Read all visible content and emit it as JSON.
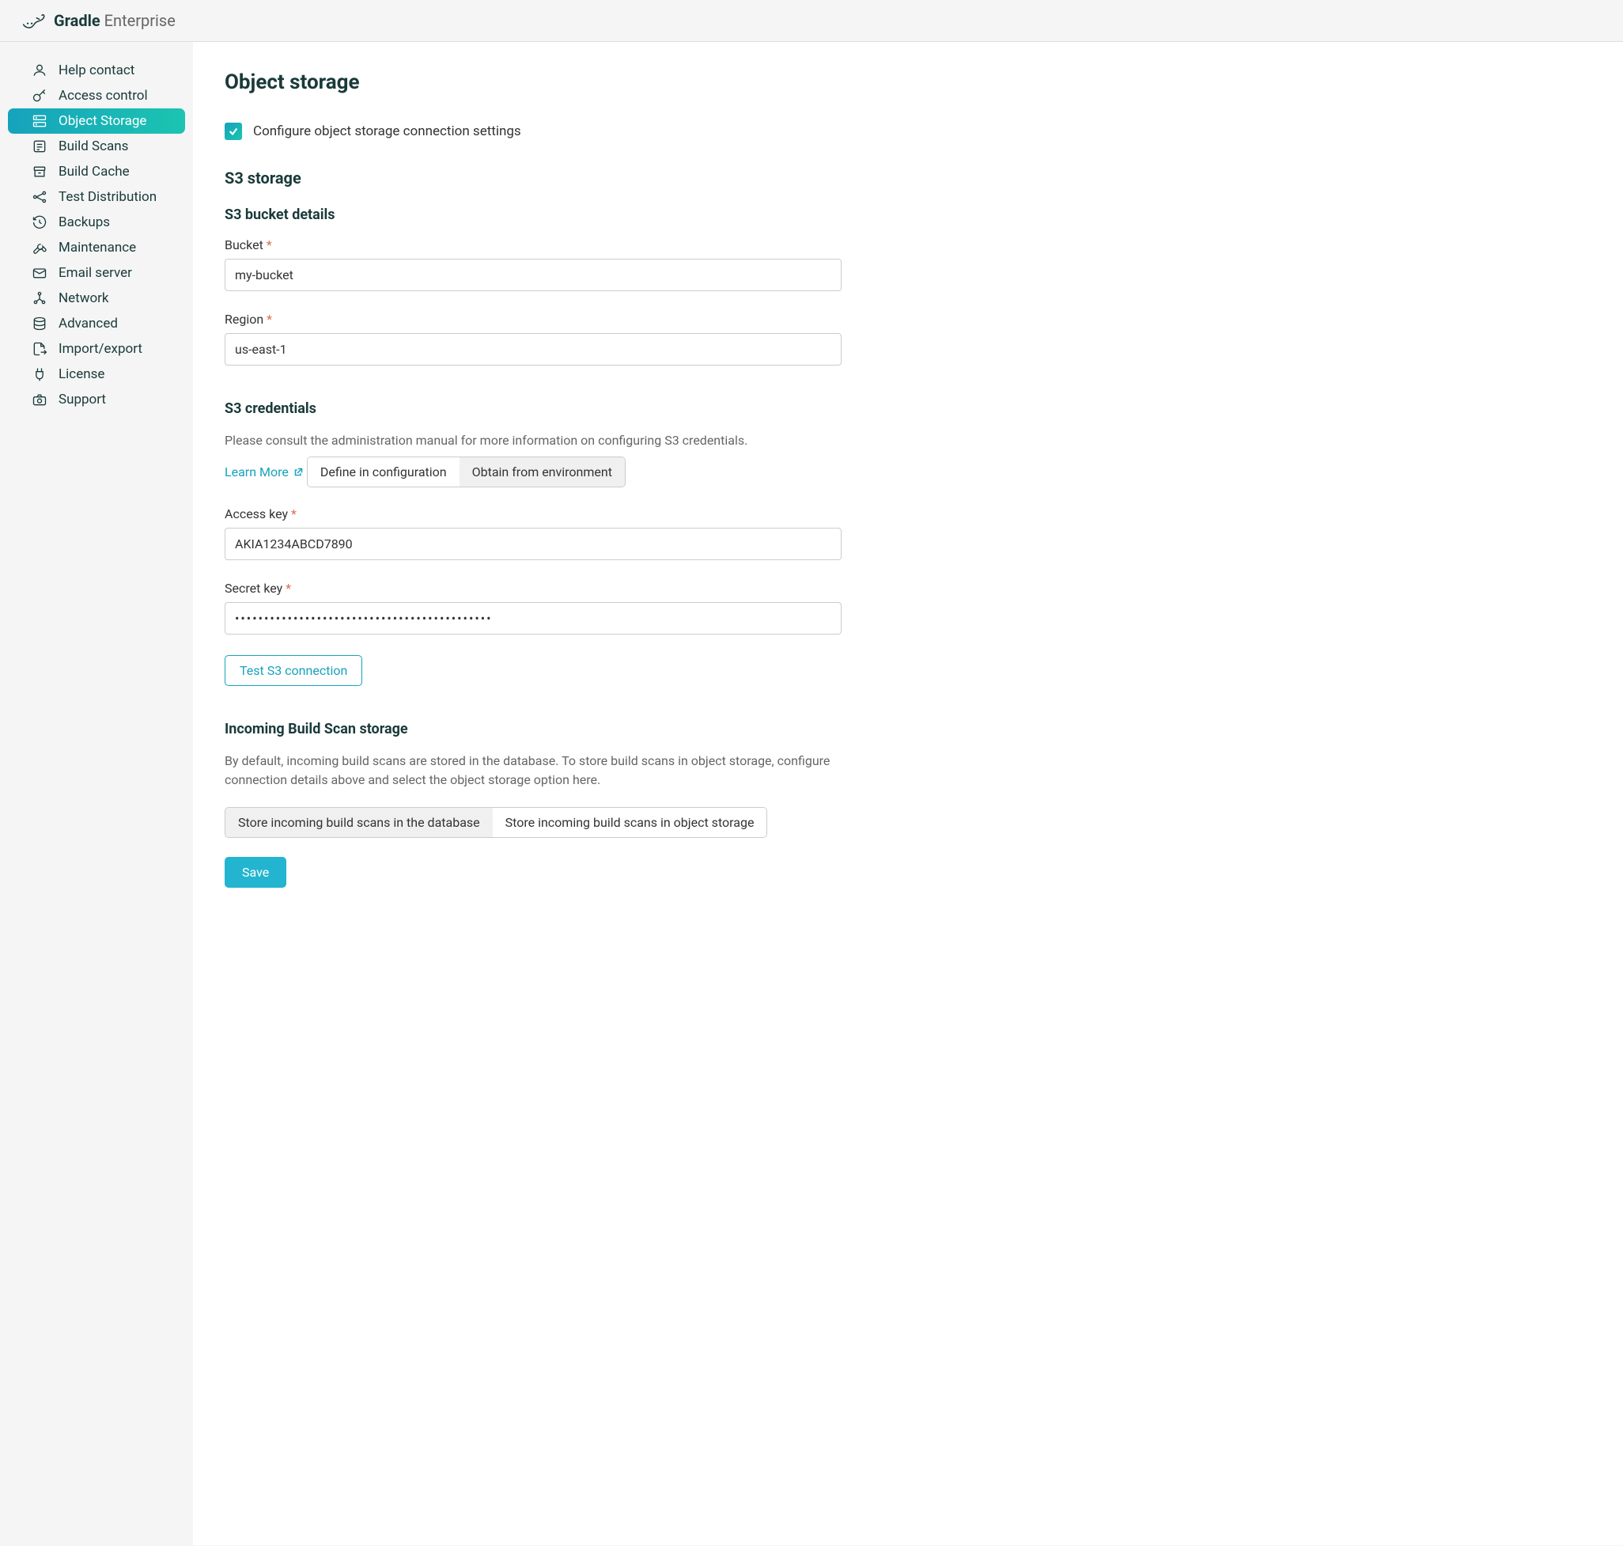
{
  "brand": {
    "bold": "Gradle",
    "light": "Enterprise"
  },
  "sidebar": {
    "items": [
      {
        "label": "Help contact",
        "id": "help-contact"
      },
      {
        "label": "Access control",
        "id": "access-control"
      },
      {
        "label": "Object Storage",
        "id": "object-storage",
        "active": true
      },
      {
        "label": "Build Scans",
        "id": "build-scans"
      },
      {
        "label": "Build Cache",
        "id": "build-cache"
      },
      {
        "label": "Test Distribution",
        "id": "test-distribution"
      },
      {
        "label": "Backups",
        "id": "backups"
      },
      {
        "label": "Maintenance",
        "id": "maintenance"
      },
      {
        "label": "Email server",
        "id": "email-server"
      },
      {
        "label": "Network",
        "id": "network"
      },
      {
        "label": "Advanced",
        "id": "advanced"
      },
      {
        "label": "Import/export",
        "id": "import-export"
      },
      {
        "label": "License",
        "id": "license"
      },
      {
        "label": "Support",
        "id": "support"
      }
    ]
  },
  "page": {
    "title": "Object storage",
    "configure_checkbox_label": "Configure object storage connection settings",
    "s3": {
      "heading": "S3 storage",
      "bucket_details_heading": "S3 bucket details",
      "bucket_label": "Bucket",
      "bucket_value": "my-bucket",
      "region_label": "Region",
      "region_value": "us-east-1",
      "credentials_heading": "S3 credentials",
      "credentials_help": "Please consult the administration manual for more information on configuring S3 credentials.",
      "learn_more": "Learn More",
      "cred_mode_define": "Define in configuration",
      "cred_mode_env": "Obtain from environment",
      "access_key_label": "Access key",
      "access_key_value": "AKIA1234ABCD7890",
      "secret_key_label": "Secret key",
      "secret_key_value": "••••••••••••••••••••••••••••••••••••••••••••",
      "test_button": "Test S3 connection"
    },
    "incoming": {
      "heading": "Incoming Build Scan storage",
      "help": "By default, incoming build scans are stored in the database. To store build scans in object storage, configure connection details above and select the object storage option here.",
      "option_db": "Store incoming build scans in the database",
      "option_obj": "Store incoming build scans in object storage"
    },
    "save_button": "Save"
  }
}
